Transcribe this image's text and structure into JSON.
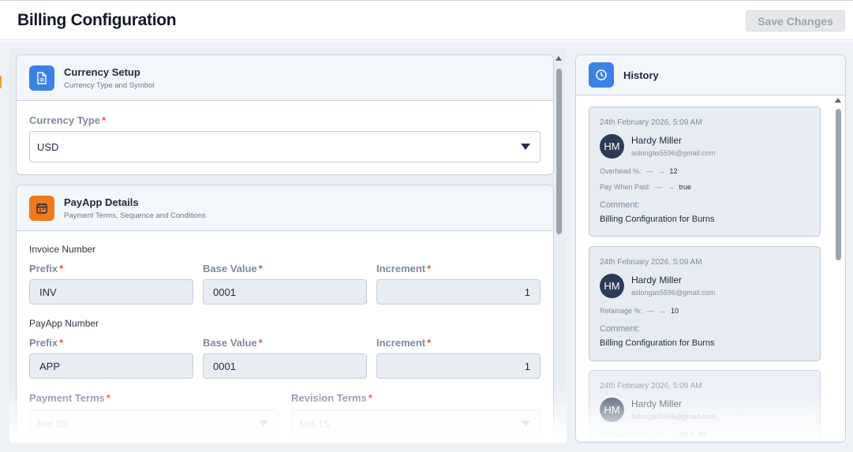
{
  "header": {
    "title": "Billing Configuration",
    "save_label": "Save Changes"
  },
  "currency": {
    "title": "Currency Setup",
    "subtitle": "Currency Type and Symbol",
    "type_label": "Currency Type",
    "type_value": "USD"
  },
  "payapp": {
    "title": "PayApp Details",
    "subtitle": "Payment Terms, Sequence and Conditions",
    "invoice": {
      "group_label": "Invoice Number",
      "prefix_label": "Prefix",
      "prefix_value": "INV",
      "base_label": "Base Value",
      "base_value": "0001",
      "increment_label": "Increment",
      "increment_value": "1"
    },
    "payapp_number": {
      "group_label": "PayApp Number",
      "prefix_label": "Prefix",
      "prefix_value": "APP",
      "base_label": "Base Value",
      "base_value": "0001",
      "increment_label": "Increment",
      "increment_value": "1"
    },
    "payment_terms_label": "Payment Terms",
    "payment_terms_value": "Net 30",
    "revision_terms_label": "Revision Terms",
    "revision_terms_value": "Net 15"
  },
  "required_mark": "*",
  "history": {
    "title": "History",
    "comment_label": "Comment:",
    "entries": [
      {
        "date": "24th February 2026, 5:09 AM",
        "initials": "HM",
        "name": "Hardy Miller",
        "email": "aslongas5596@gmail.com",
        "changes": [
          {
            "field": "Overhead %:",
            "old": "—",
            "arrow": "→",
            "new": "12"
          },
          {
            "field": "Pay When Paid:",
            "old": "—",
            "arrow": "→",
            "new": "true"
          }
        ],
        "comment": "Billing Configuration for Burns"
      },
      {
        "date": "24th February 2026, 5:09 AM",
        "initials": "HM",
        "name": "Hardy Miller",
        "email": "aslongas5596@gmail.com",
        "changes": [
          {
            "field": "Retainage %:",
            "old": "—",
            "arrow": "→",
            "new": "10"
          }
        ],
        "comment": "Billing Configuration for Burns"
      },
      {
        "date": "24th February 2026, 5:09 AM",
        "initials": "HM",
        "name": "Hardy Miller",
        "email": "aslongas5596@gmail.com",
        "changes": [
          {
            "field": "Payment Terms:",
            "old": "—",
            "arrow": "→",
            "new": "NET_30"
          }
        ]
      }
    ]
  },
  "colors": {
    "accent_blue": "#3b82e6",
    "accent_orange": "#f07a1a",
    "required": "#e0583b",
    "avatar": "#2b3c59"
  },
  "icons": {
    "currency": "document-icon",
    "payapp": "calendar-icon",
    "history": "clock-icon"
  }
}
